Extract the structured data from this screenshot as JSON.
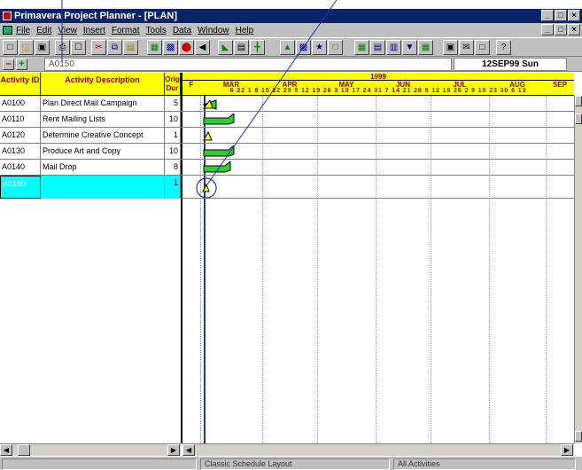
{
  "window": {
    "title": "Primavera Project Planner - [PLAN]",
    "buttons": [
      "_",
      "□",
      "×"
    ]
  },
  "menu": {
    "items": [
      "File",
      "Edit",
      "View",
      "Insert",
      "Format",
      "Tools",
      "Data",
      "Window",
      "Help"
    ]
  },
  "edit_row": {
    "plus": "+",
    "minus": "–",
    "value": "A0150",
    "date": "12SEP99 Sun"
  },
  "columns": {
    "id": "Activity ID",
    "desc": "Activity Description",
    "dur": "Orig Dur"
  },
  "activities": [
    {
      "id": "A0100",
      "desc": "Plan Direct Mail Campaign",
      "dur": "5"
    },
    {
      "id": "A0110",
      "desc": "Rent Mailing Lists",
      "dur": "10"
    },
    {
      "id": "A0120",
      "desc": "Determine Creative Concept",
      "dur": "1"
    },
    {
      "id": "A0130",
      "desc": "Produce Art and Copy",
      "dur": "10"
    },
    {
      "id": "A0140",
      "desc": "Mail Drop",
      "dur": "8"
    },
    {
      "id": "A0150",
      "desc": "",
      "dur": "1"
    }
  ],
  "timescale": {
    "year": "1999",
    "months": [
      "F",
      "MAR",
      "APR",
      "MAY",
      "JUN",
      "JUL",
      "AUG",
      "SEP"
    ],
    "days": "6 22 1 8 15 22 29 5 12 19 26 3 10 17 24 31 7 14 21 28 5 12 19 26 2 9 16 23 30 6 13"
  },
  "status": {
    "layout": "Classic Schedule Layout",
    "filter": "All Activities"
  },
  "colors": {
    "bar": "#33cc33",
    "selected": "#00ffff",
    "header": "#ffff00",
    "titlebar": "#0a246a"
  }
}
